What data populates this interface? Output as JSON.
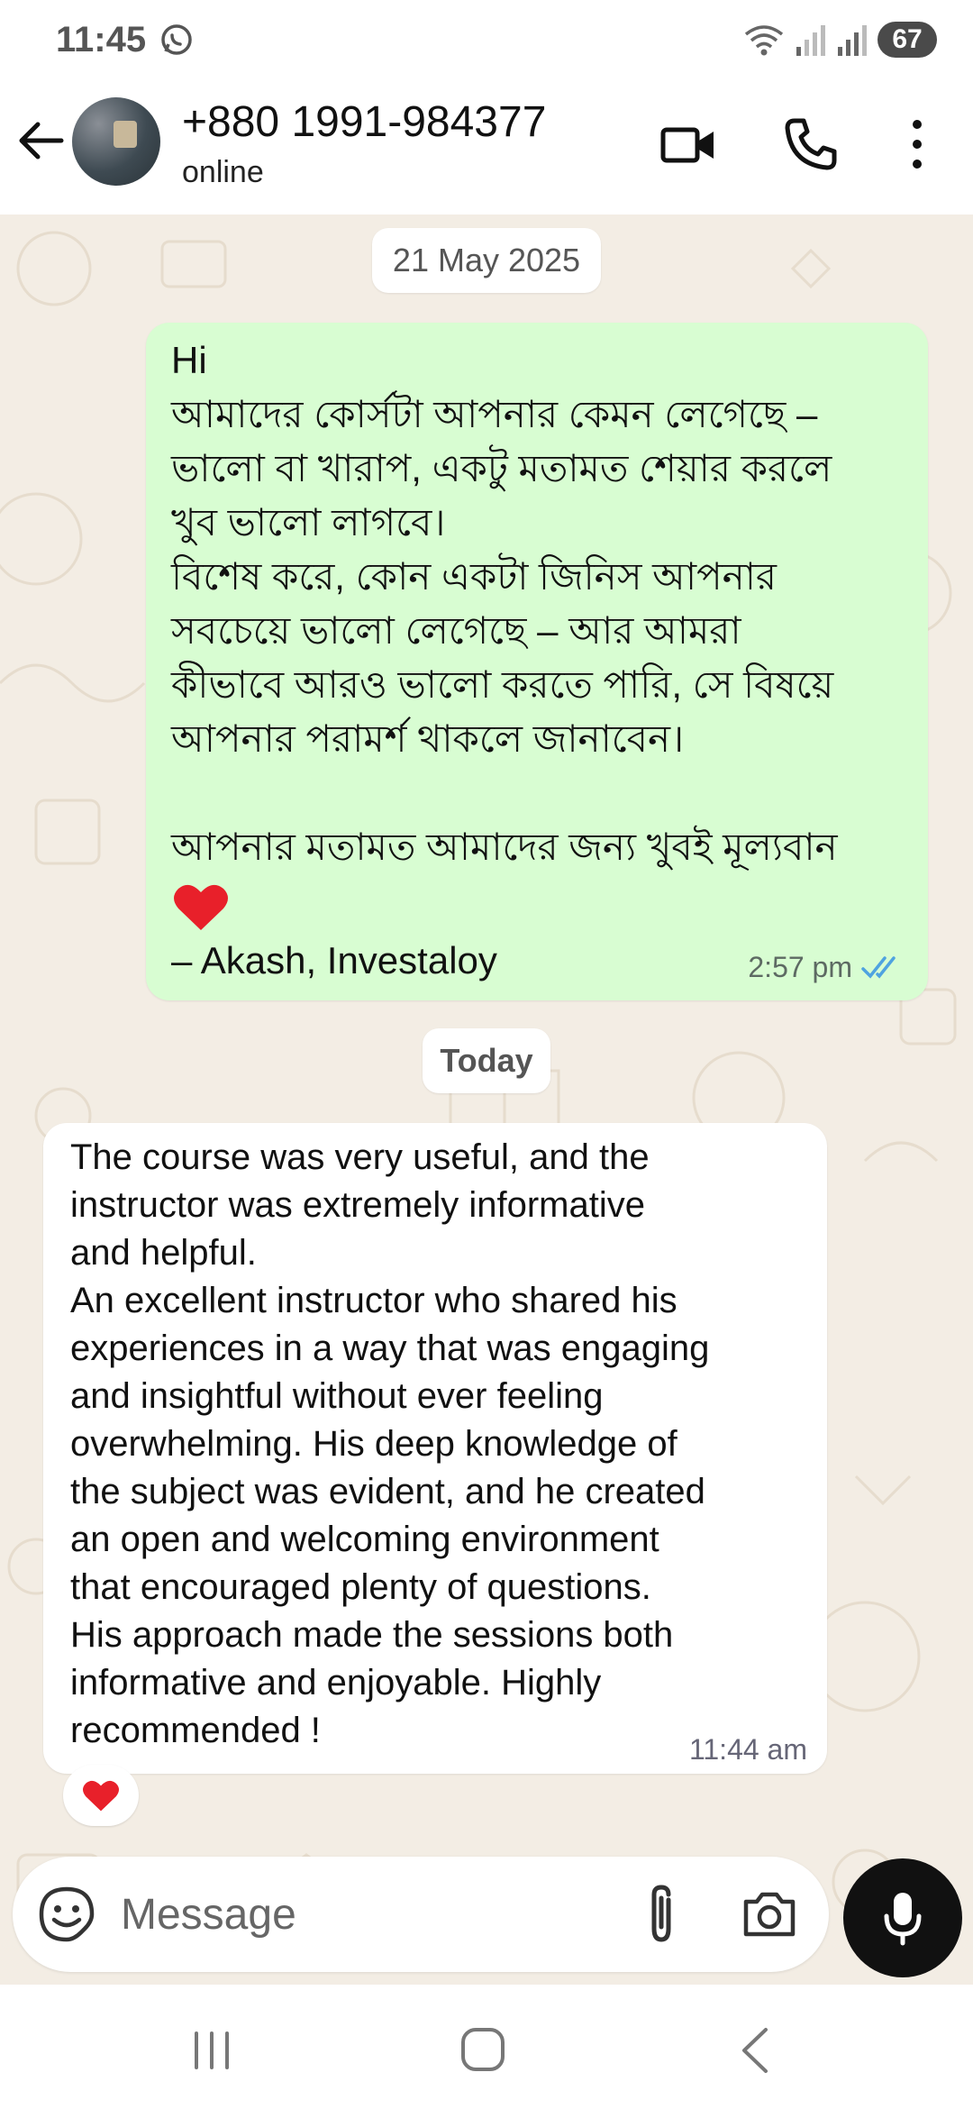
{
  "status_bar": {
    "time": "11:45",
    "battery": "67"
  },
  "header": {
    "contact_name": "+880 1991-984377",
    "contact_status": "online"
  },
  "chat": {
    "date_chip_1": "21 May 2025",
    "date_chip_2": "Today",
    "outgoing": {
      "text": "Hi\nআমাদের কোর্সটা আপনার কেমন লেগেছে –\nভালো বা খারাপ, একটু মতামত শেয়ার করলে\nখুব ভালো লাগবে।\nবিশেষ করে, কোন একটা জিনিস আপনার\nসবচেয়ে ভালো লেগেছে – আর আমরা\nকীভাবে আরও ভালো করতে পারি, সে বিষয়ে\nআপনার পরামর্শ থাকলে জানাবেন।\n\nআপনার মতামত আমাদের জন্য খুবই মূল্যবান",
      "signature": "– Akash, Investaloy",
      "time": "2:57 pm"
    },
    "incoming": {
      "text": "The course was very useful, and the\ninstructor was extremely informative\nand helpful.\nAn excellent instructor who shared his\nexperiences in a way that was engaging\nand insightful without ever feeling\noverwhelming. His deep knowledge of\nthe subject was evident, and he created\nan open and welcoming environment\nthat encouraged plenty of questions.\nHis approach made the sessions both\ninformative and enjoyable. Highly\nrecommended !",
      "time": "11:44 am"
    }
  },
  "composer": {
    "placeholder": "Message"
  },
  "colors": {
    "outgoing_bubble": "#d8fdd2",
    "chat_background": "#f3ede4",
    "read_ticks": "#4fa3e0",
    "heart": "#e8202a"
  }
}
